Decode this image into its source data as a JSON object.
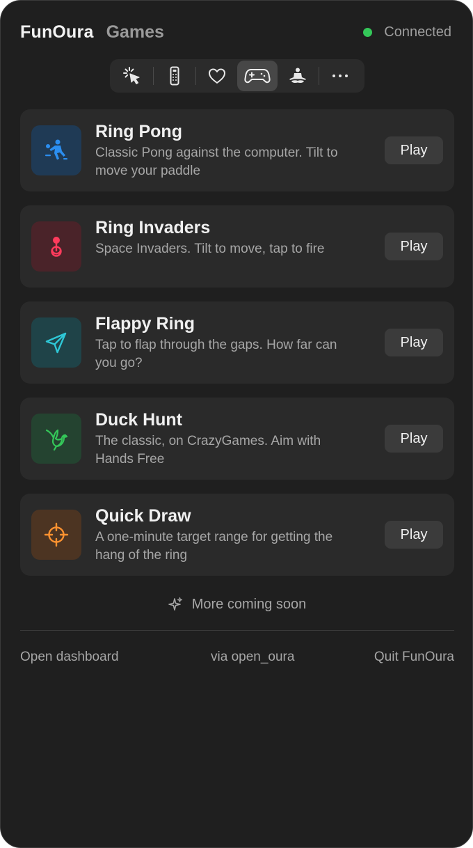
{
  "header": {
    "brand": "FunOura",
    "section": "Games",
    "status_text": "Connected",
    "status_color": "#34c759"
  },
  "toolbar": {
    "items": [
      {
        "icon": "cursor-click-icon",
        "active": false
      },
      {
        "icon": "remote-control-icon",
        "active": false
      },
      {
        "icon": "heart-icon",
        "active": false
      },
      {
        "icon": "gamepad-icon",
        "active": true
      },
      {
        "icon": "meditation-icon",
        "active": false
      },
      {
        "icon": "more-icon",
        "active": false
      }
    ]
  },
  "games": [
    {
      "title": "Ring Pong",
      "description": "Classic Pong against the computer. Tilt to move your paddle",
      "icon": "ping-pong-player-icon",
      "icon_color": "#2b8ef0",
      "icon_bg": "#1f3a55",
      "play_label": "Play"
    },
    {
      "title": "Ring Invaders",
      "description": "Space Invaders. Tilt to move, tap to fire",
      "icon": "joystick-icon",
      "icon_color": "#ff3b5c",
      "icon_bg": "#4a2329",
      "play_label": "Play"
    },
    {
      "title": "Flappy Ring",
      "description": "Tap to flap through the gaps. How far can you go?",
      "icon": "paper-plane-icon",
      "icon_color": "#2ec7d6",
      "icon_bg": "#1f4348",
      "play_label": "Play"
    },
    {
      "title": "Duck Hunt",
      "description": "The classic, on CrazyGames. Aim with Hands Free",
      "icon": "bird-icon",
      "icon_color": "#34c759",
      "icon_bg": "#244330",
      "play_label": "Play"
    },
    {
      "title": "Quick Draw",
      "description": "A one-minute target range for getting the hang of the ring",
      "icon": "crosshair-icon",
      "icon_color": "#ff9230",
      "icon_bg": "#4c3422",
      "play_label": "Play"
    }
  ],
  "coming_soon": {
    "icon": "sparkles-icon",
    "text": "More coming soon"
  },
  "footer": {
    "left": "Open dashboard",
    "middle": "via open_oura",
    "right": "Quit FunOura"
  }
}
